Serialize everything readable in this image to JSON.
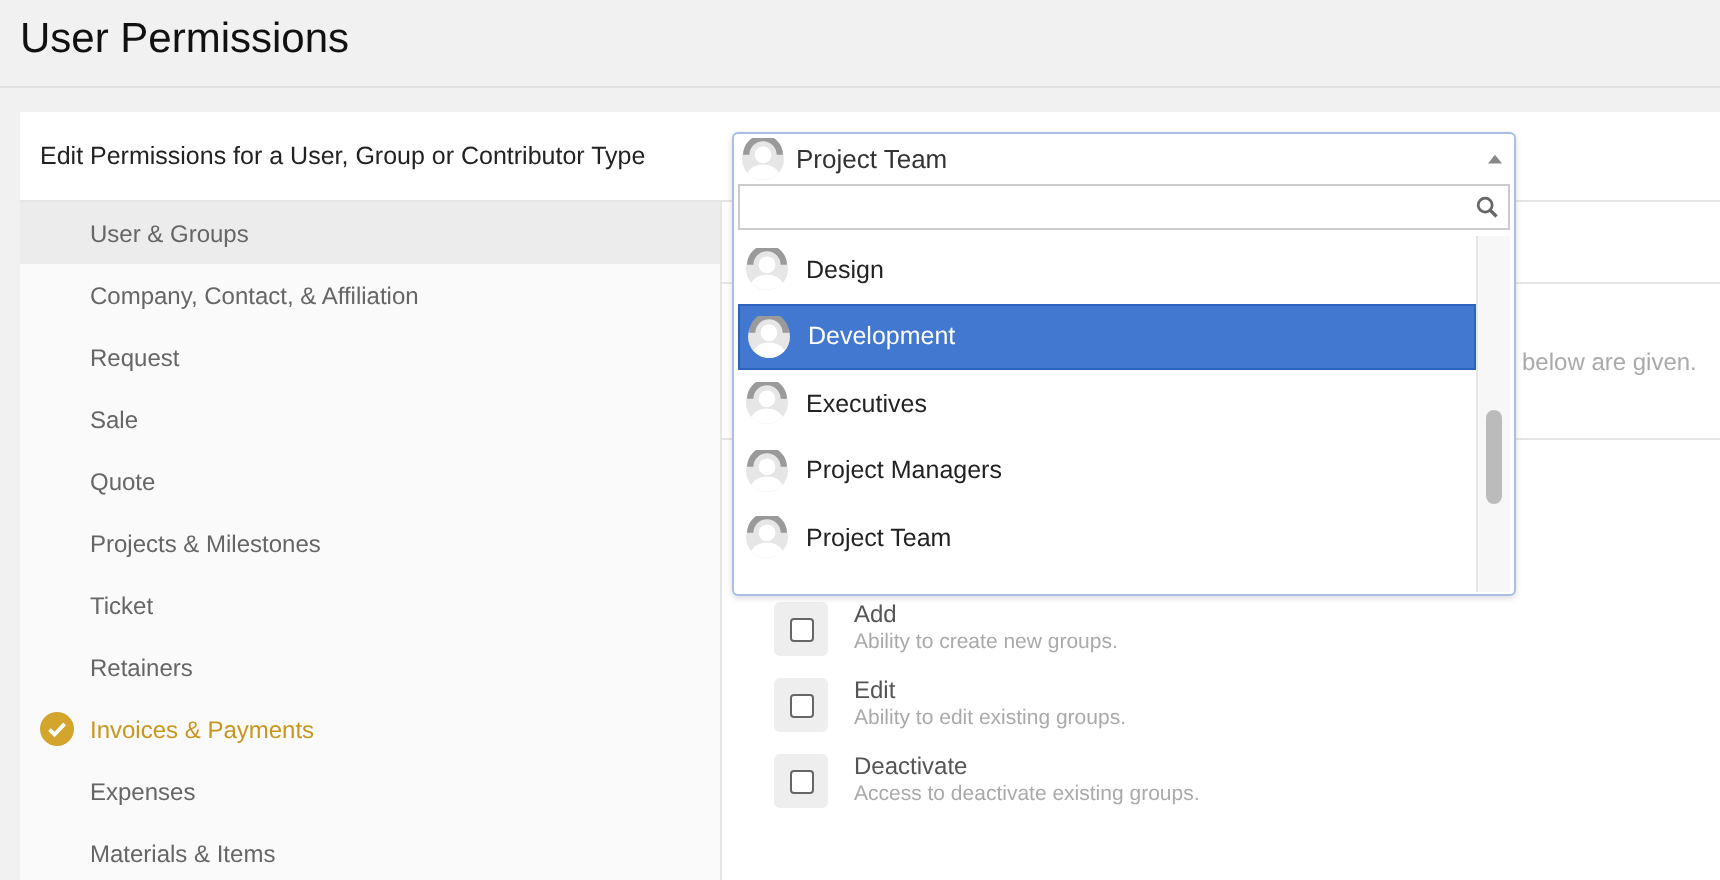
{
  "page_title": "User Permissions",
  "header": {
    "label": "Edit Permissions for a User, Group or Contributor Type"
  },
  "sidebar": {
    "items": [
      {
        "label": "User & Groups",
        "selected": true,
        "completed": false
      },
      {
        "label": "Company, Contact, & Affiliation",
        "selected": false,
        "completed": false
      },
      {
        "label": "Request",
        "selected": false,
        "completed": false
      },
      {
        "label": "Sale",
        "selected": false,
        "completed": false
      },
      {
        "label": "Quote",
        "selected": false,
        "completed": false
      },
      {
        "label": "Projects & Milestones",
        "selected": false,
        "completed": false
      },
      {
        "label": "Ticket",
        "selected": false,
        "completed": false
      },
      {
        "label": "Retainers",
        "selected": false,
        "completed": false
      },
      {
        "label": "Invoices & Payments",
        "selected": false,
        "completed": true
      },
      {
        "label": "Expenses",
        "selected": false,
        "completed": false
      },
      {
        "label": "Materials & Items",
        "selected": false,
        "completed": false
      }
    ]
  },
  "content": {
    "description_fragment": "below are given.",
    "permissions": [
      {
        "label": "Add",
        "description": "Ability to create new groups.",
        "checked": false
      },
      {
        "label": "Edit",
        "description": "Ability to edit existing groups.",
        "checked": false
      },
      {
        "label": "Deactivate",
        "description": "Access to deactivate existing groups.",
        "checked": false
      }
    ]
  },
  "dropdown": {
    "value": "Project Team",
    "options": [
      {
        "label": "Design",
        "highlighted": false
      },
      {
        "label": "Development",
        "highlighted": true
      },
      {
        "label": "Executives",
        "highlighted": false
      },
      {
        "label": "Project Managers",
        "highlighted": false
      },
      {
        "label": "Project Team",
        "highlighted": false
      }
    ]
  }
}
